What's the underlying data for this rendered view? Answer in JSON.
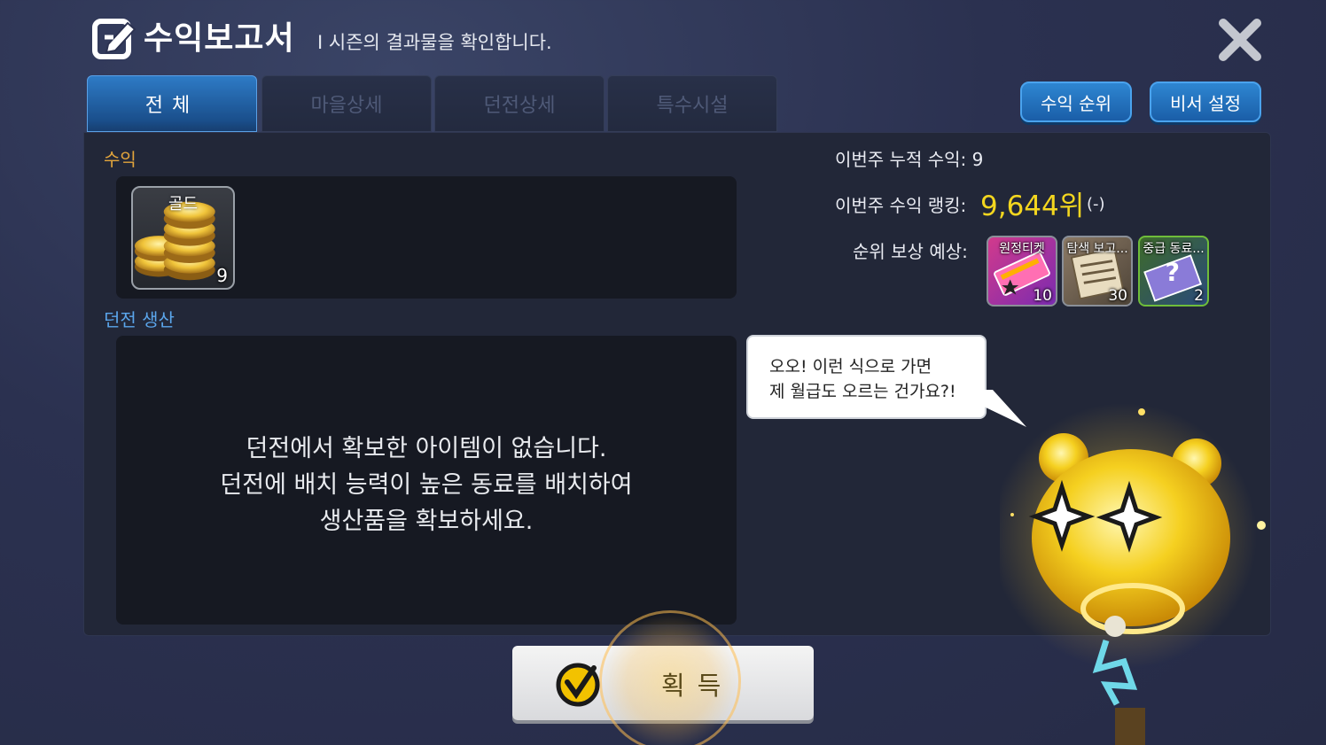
{
  "header": {
    "title": "수익보고서",
    "subtitle": "I 시즌의 결과물을 확인합니다.",
    "close_icon": "close-icon"
  },
  "tabs": [
    {
      "label": "전체",
      "active": true
    },
    {
      "label": "마을상세",
      "active": false
    },
    {
      "label": "던전상세",
      "active": false
    },
    {
      "label": "특수시설",
      "active": false
    }
  ],
  "top_buttons": {
    "ranking_label": "수익 순위",
    "secretary_label": "비서 설정"
  },
  "revenue": {
    "section_label": "수익",
    "items": [
      {
        "name": "골드",
        "count": "9",
        "icon": "gold-coins-icon"
      }
    ]
  },
  "dungeon": {
    "section_label": "던전 생산",
    "empty_lines": [
      "던전에서 확보한 아이템이 없습니다.",
      "던전에 배치 능력이 높은 동료를 배치하여",
      "생산품을 확보하세요."
    ]
  },
  "stats": {
    "weekly_label": "이번주 누적 수익: 9",
    "rank_label": "이번주 수익 랭킹:",
    "rank_value": "9,644위",
    "rank_delta": "(-)",
    "reward_label": "순위 보상 예상:",
    "rewards": [
      {
        "name": "원정티켓",
        "count": "10",
        "icon": "expedition-ticket-icon"
      },
      {
        "name": "탐색 보고...",
        "count": "30",
        "icon": "scroll-report-icon"
      },
      {
        "name": "중급 동료...",
        "count": "2",
        "icon": "mystery-companion-icon"
      }
    ]
  },
  "bubble": {
    "lines": [
      "오오! 이런 식으로 가면",
      "제 월급도 오르는 건가요?!"
    ]
  },
  "acquire": {
    "label": "획득",
    "icon": "check-circle-icon"
  },
  "colors": {
    "accent_gold": "#f3d61f",
    "revenue_label": "#e3a53c",
    "dungeon_label": "#5ba6ec",
    "tab_active": "#2e7bc6"
  }
}
